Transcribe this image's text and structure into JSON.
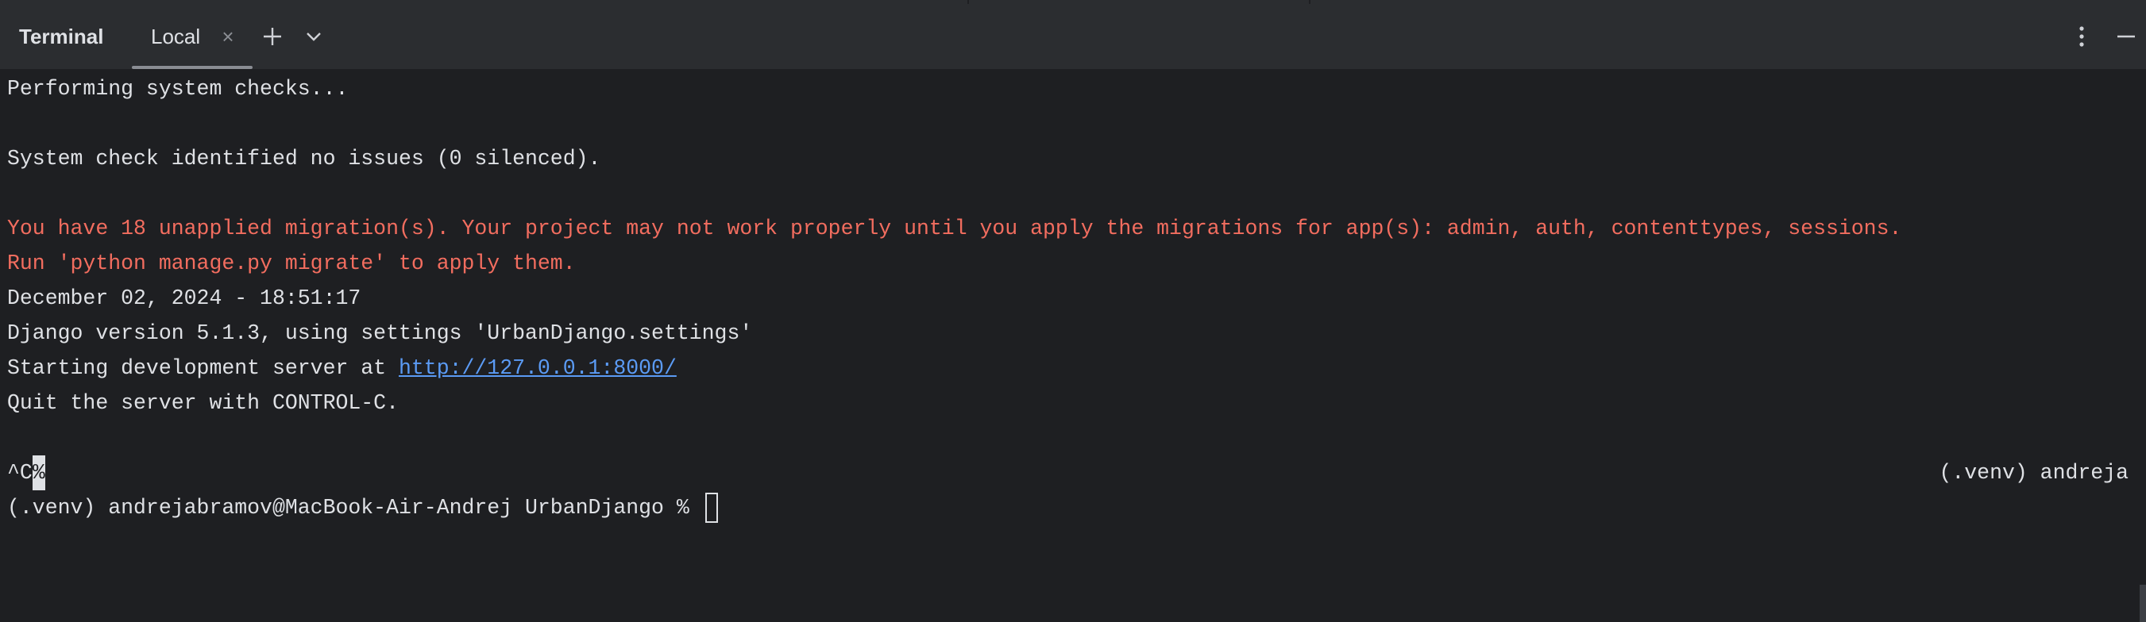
{
  "toolbar": {
    "title": "Terminal",
    "tab_label": "Local",
    "close_glyph": "×",
    "icons": [
      "close-icon",
      "plus-icon",
      "chevron-down-icon",
      "more-vertical-icon",
      "minimize-icon"
    ]
  },
  "terminal": {
    "lines": [
      "Performing system checks...",
      "",
      "System check identified no issues (0 silenced).",
      "",
      "You have 18 unapplied migration(s). Your project may not work properly until you apply the migrations for app(s): admin, auth, contenttypes, sessions.",
      "Run 'python manage.py migrate' to apply them.",
      "December 02, 2024 - 18:51:17",
      "Django version 5.1.3, using settings 'UrbanDjango.settings'",
      "Starting development server at ",
      "Quit the server with CONTROL-C."
    ],
    "server_url": "http://127.0.0.1:8000/",
    "interrupt_prefix": "^C",
    "interrupt_marker": "%",
    "right_prompt": "(.venv) andreja",
    "prompt": "(.venv) andrejabramov@MacBook-Air-Andrej UrbanDjango % "
  },
  "colors": {
    "background": "#1e1f22",
    "toolbar": "#2b2d30",
    "text": "#dfe1e5",
    "error": "#f26d5f",
    "link": "#5b9bf5"
  }
}
